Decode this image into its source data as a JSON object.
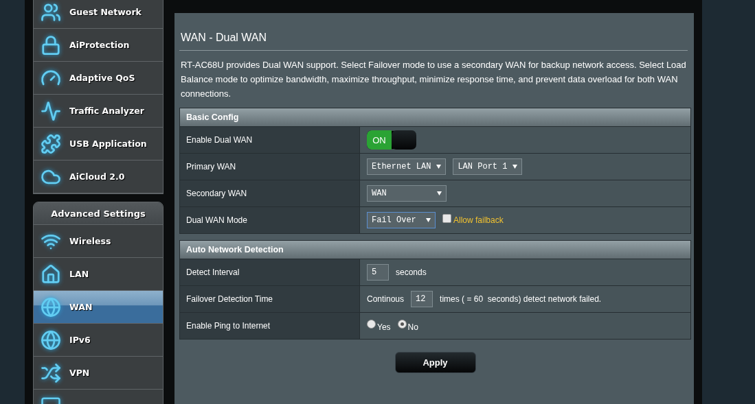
{
  "sidebar": {
    "general_items": [
      {
        "label": "Guest Network",
        "selected": false
      },
      {
        "label": "AiProtection",
        "selected": false
      },
      {
        "label": "Adaptive QoS",
        "selected": false
      },
      {
        "label": "Traffic Analyzer",
        "selected": false
      },
      {
        "label": "USB Application",
        "selected": false
      },
      {
        "label": "AiCloud 2.0",
        "selected": false
      }
    ],
    "advanced_header": "Advanced Settings",
    "advanced_items": [
      {
        "label": "Wireless",
        "selected": false
      },
      {
        "label": "LAN",
        "selected": false
      },
      {
        "label": "WAN",
        "selected": true
      },
      {
        "label": "IPv6",
        "selected": false
      },
      {
        "label": "VPN",
        "selected": false
      }
    ]
  },
  "main": {
    "title": "WAN - Dual WAN",
    "description": "RT-AC68U provides Dual WAN support. Select Failover mode to use a secondary WAN for backup network access. Select Load Balance mode to optimize bandwidth, maximize throughput, minimize response time, and prevent data overload for both WAN connections.",
    "sections": [
      {
        "title": "Basic Config",
        "rows": [
          {
            "label": "Enable Dual WAN",
            "controls": [
              {
                "kind": "switch",
                "on": true,
                "text": "ON"
              }
            ]
          },
          {
            "label": "Primary WAN",
            "controls": [
              {
                "kind": "select",
                "value": "Ethernet LAN",
                "focused": false
              },
              {
                "kind": "select",
                "value": "LAN Port 1",
                "focused": false
              }
            ]
          },
          {
            "label": "Secondary WAN",
            "controls": [
              {
                "kind": "select",
                "value": "WAN",
                "focused": false
              }
            ]
          },
          {
            "label": "Dual WAN Mode",
            "controls": [
              {
                "kind": "select",
                "value": "Fail Over",
                "focused": true
              },
              {
                "kind": "checkbox",
                "label": "Allow failback",
                "checked": false
              }
            ]
          }
        ]
      },
      {
        "title": "Auto Network Detection",
        "rows": [
          {
            "label": "Detect Interval",
            "controls": [
              {
                "kind": "input",
                "value": "5"
              },
              {
                "kind": "text",
                "text": "seconds"
              }
            ]
          },
          {
            "label": "Failover Detection Time",
            "controls": [
              {
                "kind": "text",
                "text": "Continous"
              },
              {
                "kind": "input",
                "value": "12"
              },
              {
                "kind": "text",
                "text": "times ( = 60  seconds) detect network failed."
              }
            ]
          },
          {
            "label": "Enable Ping to Internet",
            "controls": [
              {
                "kind": "radio",
                "label": "Yes",
                "selected": false
              },
              {
                "kind": "radio",
                "label": "No",
                "selected": true
              }
            ]
          }
        ]
      }
    ],
    "apply_button": "Apply"
  }
}
